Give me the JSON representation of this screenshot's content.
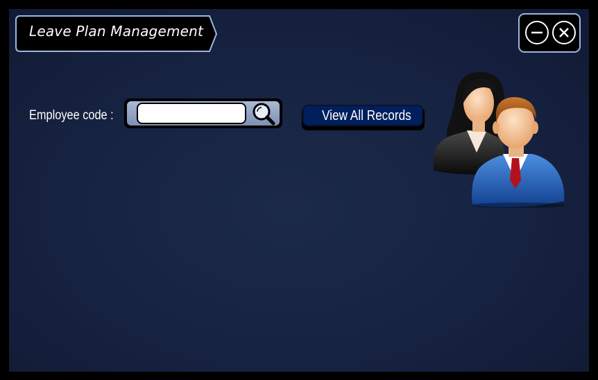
{
  "window": {
    "title": "Leave Plan Management"
  },
  "controls": {
    "minimize_icon": "minus-circle-icon",
    "close_icon": "close-circle-icon"
  },
  "form": {
    "employee_code_label": "Employee code :",
    "employee_code_value": "",
    "search_icon": "magnifier-icon",
    "view_all_label": "View All Records"
  },
  "illustration": {
    "icon": "users-icon"
  },
  "colors": {
    "background": "#162241",
    "frame": "#000000",
    "accent_border": "#9cb7e0",
    "button_fill": "#001f5c",
    "search_frame": "#8fa0c2"
  }
}
